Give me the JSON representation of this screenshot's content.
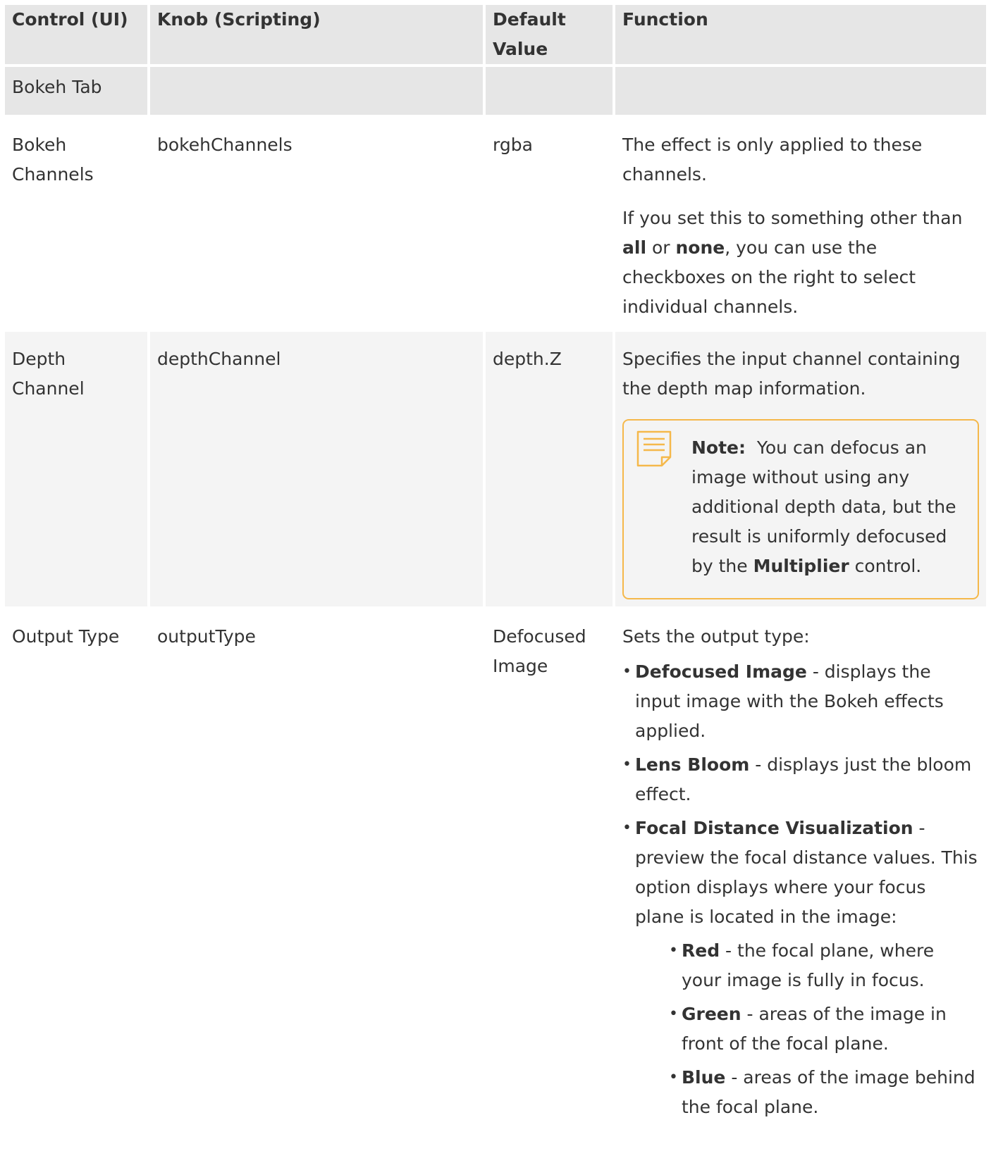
{
  "table": {
    "headers": {
      "col1": "Control (UI)",
      "col2": "Knob (Scripting)",
      "col3_line1": "Default",
      "col3_line2": "Value",
      "col4": "Function"
    },
    "section_title": "Bokeh Tab",
    "rows": [
      {
        "control_line1": "Bokeh",
        "control_line2": "Channels",
        "knob": "bokehChannels",
        "default": "rgba",
        "function_p1": "The effect is only applied to these channels.",
        "function_p2": {
          "t1": "If you set this to something other than ",
          "b1": "all",
          "t2": " or ",
          "b2": "none",
          "t3": ", you can use the checkboxes on the right to select individual channels."
        }
      },
      {
        "control_line1": "Depth",
        "control_line2": "Channel",
        "knob": "depthChannel",
        "default": "depth.Z",
        "function_p1": "Specifies the input channel containing the depth map information.",
        "note": {
          "label": "Note:",
          "t1": "You can defocus an image without using any additional depth data, but the result is uniformly defocused by the ",
          "b1": "Multiplier",
          "t2": " control."
        }
      },
      {
        "control": "Output Type",
        "knob": "outputType",
        "default_line1": "Defocused",
        "default_line2": "Image",
        "function_intro": "Sets the output type:",
        "options": [
          {
            "name": "Defocused Image",
            "desc": " - displays the input image with the Bokeh effects applied."
          },
          {
            "name": "Lens Bloom",
            "desc": " - displays just the bloom effect."
          },
          {
            "name": "Focal Distance Visualization",
            "desc": " - preview the focal distance values. This option displays where your focus plane is located in the image:"
          }
        ],
        "sub_options": [
          {
            "name": "Red",
            "desc": " - the focal plane, where your image is fully in focus."
          },
          {
            "name": "Green",
            "desc": " - areas of the image in front of the focal plane."
          },
          {
            "name": "Blue",
            "desc": " - areas of the image behind the focal plane."
          }
        ]
      }
    ]
  },
  "colors": {
    "header_bg": "#e6e6e6",
    "row_alt_bg": "#f4f4f4",
    "note_border": "#f5b84a",
    "text": "#333333"
  },
  "icons": {
    "note": "note-document-icon"
  }
}
